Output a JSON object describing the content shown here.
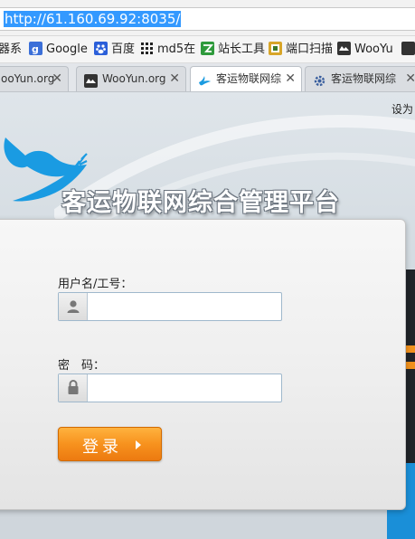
{
  "browser": {
    "url": "http://61.160.69.92:8035/"
  },
  "bookmarks": [
    {
      "label": "器系",
      "icon": "bookmark-icon"
    },
    {
      "label": "Google",
      "icon": "google-icon"
    },
    {
      "label": "百度",
      "icon": "baidu-paw-icon"
    },
    {
      "label": "md5在",
      "icon": "grid-icon"
    },
    {
      "label": "站长工具",
      "icon": "chinaz-icon"
    },
    {
      "label": "端口扫描",
      "icon": "port-scan-icon"
    },
    {
      "label": "WooYu",
      "icon": "wooyun-icon"
    }
  ],
  "tabs": [
    {
      "label": "ooYun.org",
      "icon": "none",
      "active": false
    },
    {
      "label": "WooYun.org",
      "icon": "wooyun-icon",
      "active": false
    },
    {
      "label": "客运物联网综",
      "icon": "dove-icon",
      "active": true
    },
    {
      "label": "客运物联网综",
      "icon": "loading-gear-icon",
      "active": false
    }
  ],
  "page": {
    "set_as": "设为",
    "title": "客运物联网综合管理平台",
    "login": {
      "username_label": "用户名/工号：",
      "username_value": "",
      "password_label": "密　码：",
      "password_value": "",
      "submit_label": "登录"
    }
  },
  "colors": {
    "accent_orange": "#f7921e",
    "brand_blue": "#1a8fd8",
    "url_highlight": "#3399ff"
  }
}
